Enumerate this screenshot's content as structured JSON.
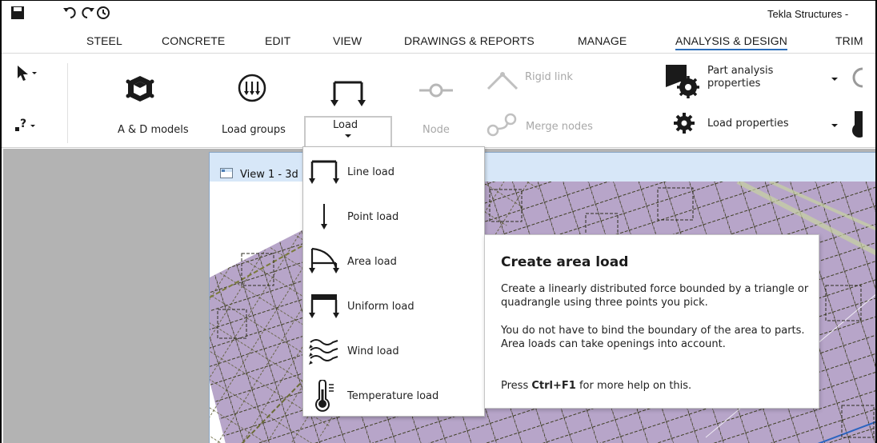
{
  "title_bar": {
    "app_title": "Tekla Structures -"
  },
  "quick_access": {
    "icons": [
      "save-icon",
      "undo-icon",
      "redo-icon",
      "history-icon"
    ]
  },
  "tabs": [
    {
      "label": "STEEL"
    },
    {
      "label": "CONCRETE"
    },
    {
      "label": "EDIT"
    },
    {
      "label": "VIEW"
    },
    {
      "label": "DRAWINGS & REPORTS"
    },
    {
      "label": "MANAGE"
    },
    {
      "label": "ANALYSIS & DESIGN",
      "active": true
    },
    {
      "label": "TRIM"
    }
  ],
  "ribbon": {
    "ad_models": "A & D models",
    "load_groups": "Load groups",
    "load": "Load",
    "node": "Node",
    "rigid_link": "Rigid link",
    "merge_nodes": "Merge nodes",
    "part_analysis_properties_line1": "Part analysis",
    "part_analysis_properties_line2": "properties",
    "load_properties": "Load properties"
  },
  "view": {
    "title": "View 1 - 3d"
  },
  "load_menu": {
    "items": [
      {
        "label": "Line load",
        "icon": "line-load-icon"
      },
      {
        "label": "Point load",
        "icon": "point-load-icon"
      },
      {
        "label": "Area load",
        "icon": "area-load-icon"
      },
      {
        "label": "Uniform load",
        "icon": "uniform-load-icon"
      },
      {
        "label": "Wind load",
        "icon": "wind-load-icon"
      },
      {
        "label": "Temperature load",
        "icon": "temperature-load-icon"
      }
    ]
  },
  "tooltip": {
    "title": "Create area load",
    "para1": "Create a linearly distributed force bounded by a triangle or quadrangle using three points you pick.",
    "para2": "You do not have to bind the boundary of the area to parts. Area loads can take openings into account.",
    "para3_prefix": "Press ",
    "para3_key": "Ctrl+F1",
    "para3_suffix": " for more help on this."
  },
  "colors": {
    "accent": "#2b6cb8",
    "model_fill": "#b7a5c9",
    "workspace": "#b3b3b3",
    "view_title": "#d7e7f8"
  }
}
